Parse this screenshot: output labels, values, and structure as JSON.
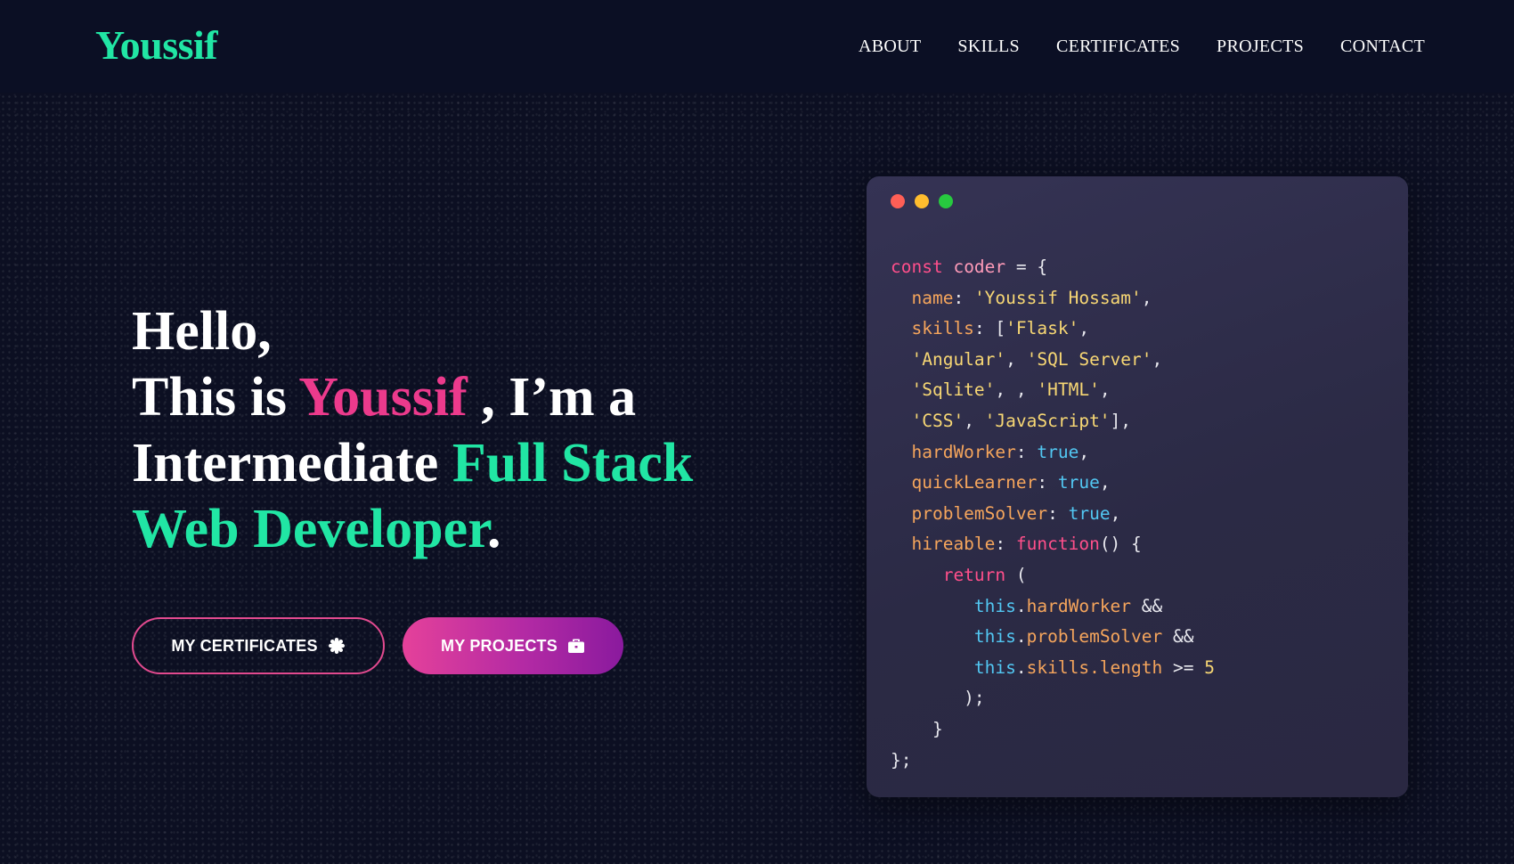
{
  "brand": {
    "logo": "Youssif"
  },
  "nav": {
    "items": [
      {
        "label": "ABOUT"
      },
      {
        "label": "SKILLS"
      },
      {
        "label": "CERTIFICATES"
      },
      {
        "label": "PROJECTS"
      },
      {
        "label": "CONTACT"
      }
    ]
  },
  "hero": {
    "line1": "Hello,",
    "line2_prefix": "This is ",
    "line2_name": "Youssif",
    "line2_suffix": " , I’m a",
    "line3_prefix": "Intermediate ",
    "line3_highlight": "Full Stack",
    "line4_highlight": "Web Developer",
    "line4_suffix": "."
  },
  "buttons": {
    "certificates": {
      "label": "MY CERTIFICATES",
      "icon": "badge-icon"
    },
    "projects": {
      "label": "MY PROJECTS",
      "icon": "briefcase-icon"
    }
  },
  "code_window": {
    "controls": [
      "close-dot",
      "minimize-dot",
      "maximize-dot"
    ],
    "lines": [
      [
        {
          "t": "kw",
          "v": "const"
        },
        {
          "t": "plain",
          "v": " "
        },
        {
          "t": "var",
          "v": "coder"
        },
        {
          "t": "plain",
          "v": " = {"
        }
      ],
      [
        {
          "t": "plain",
          "v": "  "
        },
        {
          "t": "prop",
          "v": "name"
        },
        {
          "t": "plain",
          "v": ": "
        },
        {
          "t": "str",
          "v": "'Youssif Hossam'"
        },
        {
          "t": "plain",
          "v": ","
        }
      ],
      [
        {
          "t": "plain",
          "v": "  "
        },
        {
          "t": "prop",
          "v": "skills"
        },
        {
          "t": "plain",
          "v": ": ["
        },
        {
          "t": "str",
          "v": "'Flask'"
        },
        {
          "t": "plain",
          "v": ","
        }
      ],
      [
        {
          "t": "plain",
          "v": "  "
        },
        {
          "t": "str",
          "v": "'Angular'"
        },
        {
          "t": "plain",
          "v": ", "
        },
        {
          "t": "str",
          "v": "'SQL Server'"
        },
        {
          "t": "plain",
          "v": ","
        }
      ],
      [
        {
          "t": "plain",
          "v": "  "
        },
        {
          "t": "str",
          "v": "'Sqlite'"
        },
        {
          "t": "plain",
          "v": ", , "
        },
        {
          "t": "str",
          "v": "'HTML'"
        },
        {
          "t": "plain",
          "v": ","
        }
      ],
      [
        {
          "t": "plain",
          "v": "  "
        },
        {
          "t": "str",
          "v": "'CSS'"
        },
        {
          "t": "plain",
          "v": ", "
        },
        {
          "t": "str",
          "v": "'JavaScript'"
        },
        {
          "t": "plain",
          "v": "],"
        }
      ],
      [
        {
          "t": "plain",
          "v": "  "
        },
        {
          "t": "prop",
          "v": "hardWorker"
        },
        {
          "t": "plain",
          "v": ": "
        },
        {
          "t": "bool",
          "v": "true"
        },
        {
          "t": "plain",
          "v": ","
        }
      ],
      [
        {
          "t": "plain",
          "v": "  "
        },
        {
          "t": "prop",
          "v": "quickLearner"
        },
        {
          "t": "plain",
          "v": ": "
        },
        {
          "t": "bool",
          "v": "true"
        },
        {
          "t": "plain",
          "v": ","
        }
      ],
      [
        {
          "t": "plain",
          "v": "  "
        },
        {
          "t": "prop",
          "v": "problemSolver"
        },
        {
          "t": "plain",
          "v": ": "
        },
        {
          "t": "bool",
          "v": "true"
        },
        {
          "t": "plain",
          "v": ","
        }
      ],
      [
        {
          "t": "plain",
          "v": "  "
        },
        {
          "t": "prop",
          "v": "hireable"
        },
        {
          "t": "plain",
          "v": ": "
        },
        {
          "t": "kw",
          "v": "function"
        },
        {
          "t": "plain",
          "v": "() {"
        }
      ],
      [
        {
          "t": "plain",
          "v": "     "
        },
        {
          "t": "kw",
          "v": "return"
        },
        {
          "t": "plain",
          "v": " ("
        }
      ],
      [
        {
          "t": "plain",
          "v": "        "
        },
        {
          "t": "thisk",
          "v": "this"
        },
        {
          "t": "plain",
          "v": "."
        },
        {
          "t": "prop",
          "v": "hardWorker"
        },
        {
          "t": "plain",
          "v": " &&"
        }
      ],
      [
        {
          "t": "plain",
          "v": "        "
        },
        {
          "t": "thisk",
          "v": "this"
        },
        {
          "t": "plain",
          "v": "."
        },
        {
          "t": "prop",
          "v": "problemSolver"
        },
        {
          "t": "plain",
          "v": " &&"
        }
      ],
      [
        {
          "t": "plain",
          "v": "        "
        },
        {
          "t": "thisk",
          "v": "this"
        },
        {
          "t": "plain",
          "v": "."
        },
        {
          "t": "prop",
          "v": "skills.length"
        },
        {
          "t": "plain",
          "v": " >= "
        },
        {
          "t": "num",
          "v": "5"
        }
      ],
      [
        {
          "t": "plain",
          "v": "       );"
        }
      ],
      [
        {
          "t": "plain",
          "v": "    }"
        }
      ],
      [
        {
          "t": "plain",
          "v": "};"
        }
      ]
    ]
  },
  "colors": {
    "accent_green": "#21e6a4",
    "accent_pink": "#ec3a8c",
    "background": "#0c0f22",
    "code_bg": "#2f2d4b"
  }
}
